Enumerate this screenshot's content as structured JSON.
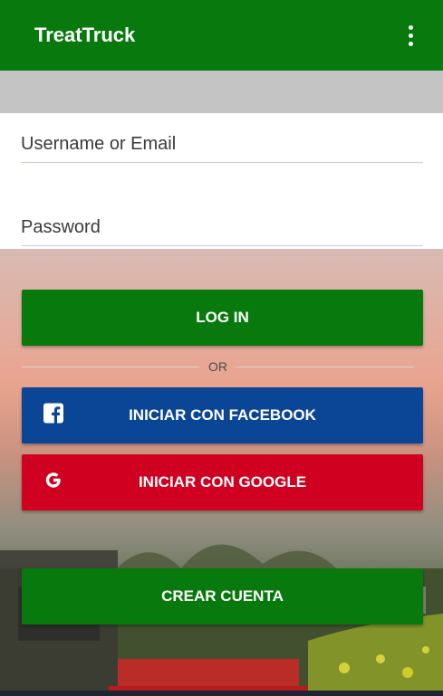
{
  "app_bar": {
    "title": "TreatTruck",
    "menu_icon": "more-vert-icon"
  },
  "form": {
    "username_placeholder": "Username or Email",
    "password_placeholder": "Password"
  },
  "buttons": {
    "login": "LOG IN",
    "or": "OR",
    "facebook": "INICIAR CON FACEBOOK",
    "google": "INICIAR CON GOOGLE",
    "create_account": "CREAR CUENTA"
  },
  "colors": {
    "primary_green": "#087a0d",
    "facebook_blue": "#0b4596",
    "google_red": "#d00020"
  }
}
